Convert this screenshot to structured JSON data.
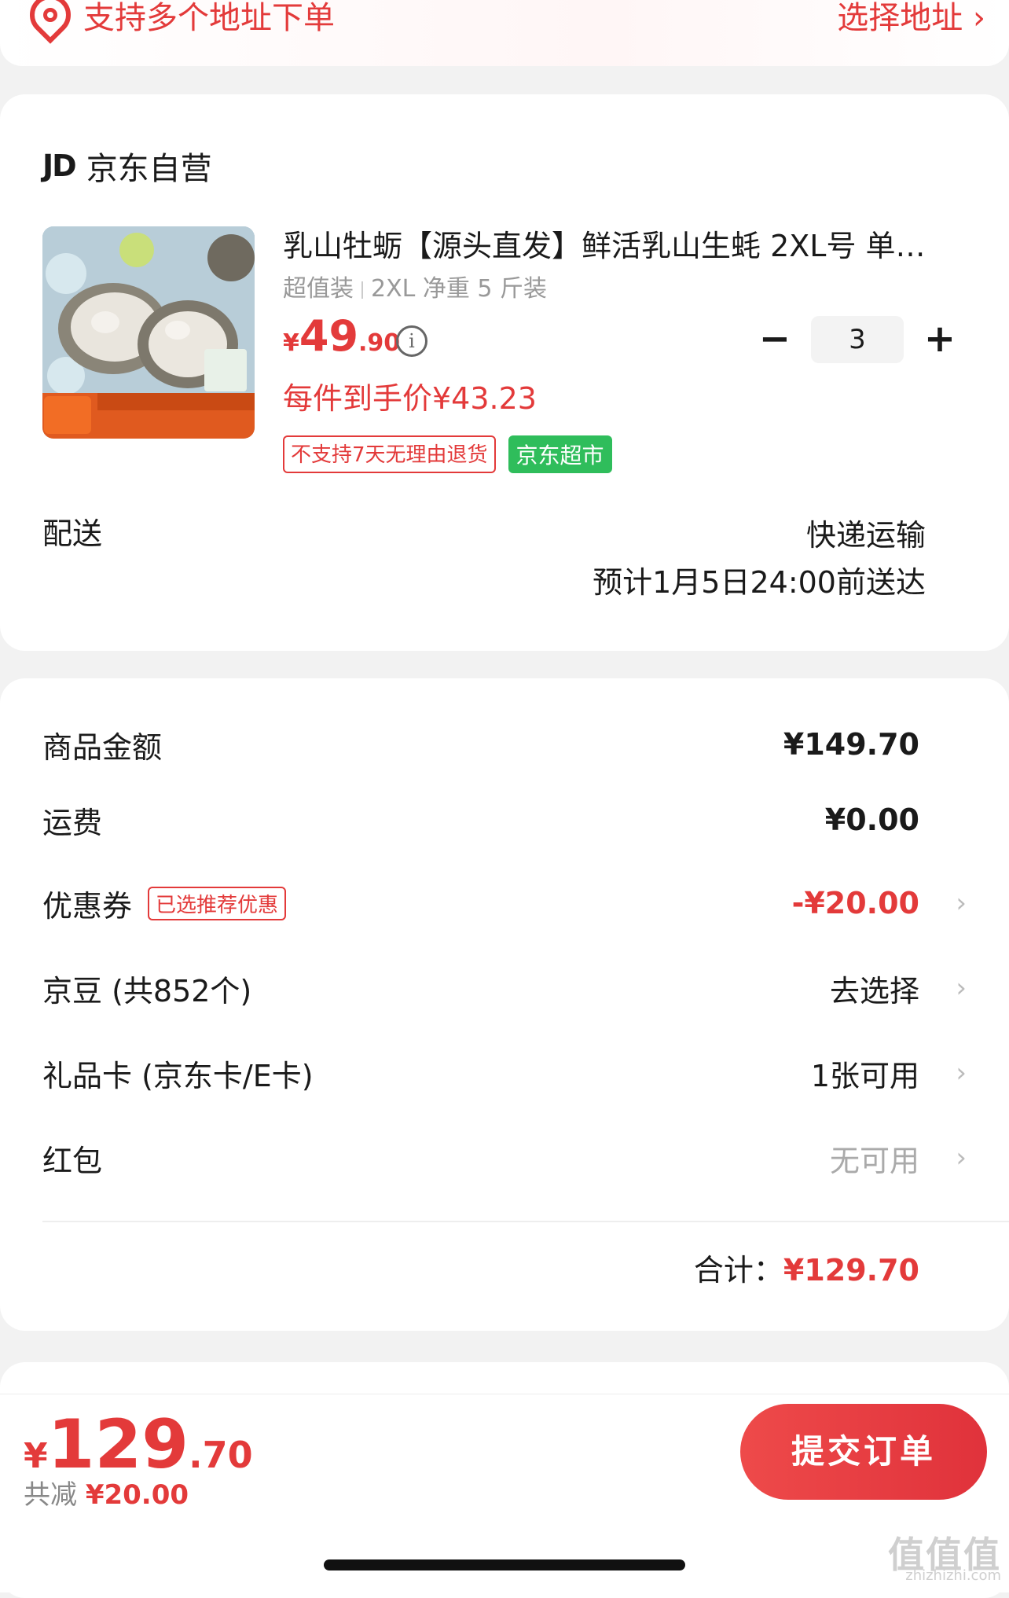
{
  "address": {
    "prompt": "支持多个地址下单",
    "select": "选择地址 ›"
  },
  "shop": {
    "logo": "JD",
    "name": "京东自营"
  },
  "product": {
    "title": "乳山牡蛎【源头直发】鲜活乳山生蚝 2XL号 单…",
    "spec_a": "超值装",
    "spec_b": "2XL 净重 5 斤装",
    "price_currency": "¥",
    "price_int": "49",
    "price_dec": ".90",
    "info_icon": "i",
    "per_price": "每件到手价¥43.23",
    "quantity": "3",
    "minus": "−",
    "plus": "+",
    "tag_return": "不支持7天无理由退货",
    "tag_market": "京东超市"
  },
  "shipping": {
    "label": "配送",
    "method": "快递运输",
    "eta": "预计1月5日24:00前送达"
  },
  "summary": {
    "goods_label": "商品金额",
    "goods_value": "¥149.70",
    "freight_label": "运费",
    "freight_value": "¥0.00",
    "coupon_label": "优惠券",
    "coupon_badge": "已选推荐优惠",
    "coupon_value": "-¥20.00",
    "beans_label": "京豆 (共852个)",
    "beans_value": "去选择",
    "giftcard_label": "礼品卡 (京东卡/E卡)",
    "giftcard_value": "1张可用",
    "redpacket_label": "红包",
    "redpacket_value": "无可用",
    "chevron": "›",
    "total_label": "合计：",
    "total_value": "¥129.70"
  },
  "bottom": {
    "currency": "¥",
    "total_int": "129",
    "total_dec": ".70",
    "reduce_label": "共减",
    "reduce_value": "¥20.00",
    "submit": "提交订单"
  },
  "watermark": {
    "text": "值值值",
    "site": "zhizhizhi.com"
  },
  "colors": {
    "accent": "#e33a3a",
    "green_tag": "#2fbd5b"
  }
}
